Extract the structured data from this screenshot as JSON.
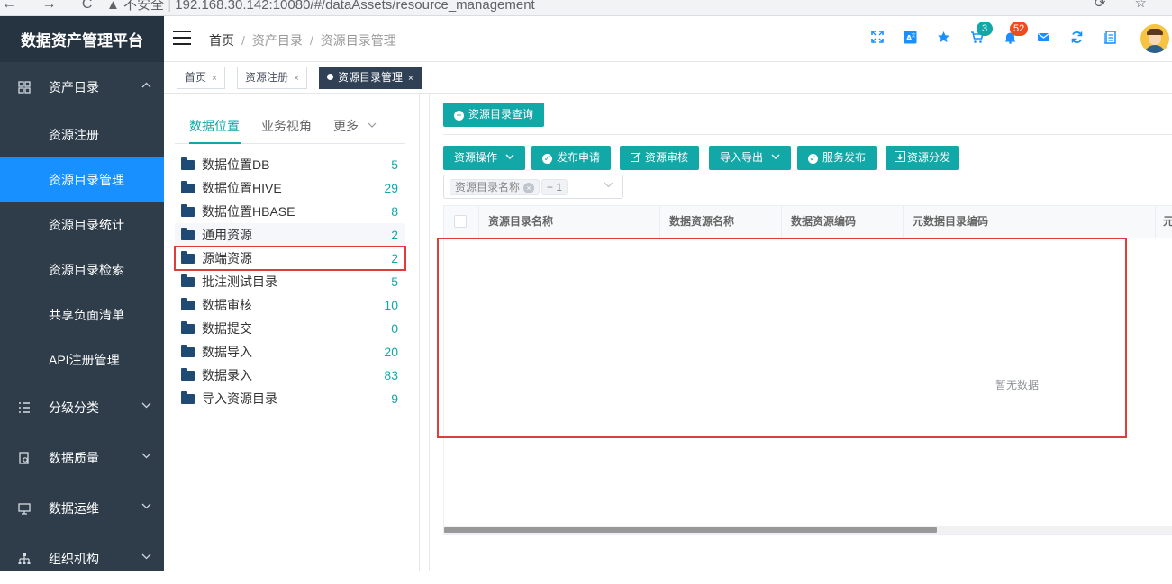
{
  "browser": {
    "nav_glyphs": "← → C",
    "security": "▲ 不安全",
    "url": "192.168.30.142:10080/#/dataAssets/resource_management",
    "right_glyphs": "⟳ ☆"
  },
  "sidebar": {
    "title": "数据资产管理平台",
    "group_assets": {
      "label": "资产目录",
      "icon": "grid-icon",
      "arrow": "^"
    },
    "sub_items": [
      {
        "label": "资源注册",
        "active": false
      },
      {
        "label": "资源目录管理",
        "active": true
      },
      {
        "label": "资源目录统计",
        "active": false
      },
      {
        "label": "资源目录检索",
        "active": false
      },
      {
        "label": "共享负面清单",
        "active": false
      },
      {
        "label": "API注册管理",
        "active": false
      }
    ],
    "groups": [
      {
        "label": "分级分类",
        "icon": "list-icon",
        "arrow": "⌄"
      },
      {
        "label": "数据质量",
        "icon": "doc-search-icon",
        "arrow": "⌄"
      },
      {
        "label": "数据运维",
        "icon": "monitor-icon",
        "arrow": "⌄"
      },
      {
        "label": "组织机构",
        "icon": "org-icon",
        "arrow": "⌄"
      }
    ]
  },
  "header": {
    "breadcrumb": [
      "首页",
      "资产目录",
      "资源目录管理"
    ],
    "cart_badge": "3",
    "bell_badge": "52"
  },
  "tags": [
    {
      "label": "首页"
    },
    {
      "label": "资源注册"
    },
    {
      "label": "资源目录管理"
    }
  ],
  "tree": {
    "tabs": [
      "数据位置",
      "业务视角",
      "更多"
    ],
    "items": [
      {
        "label": "数据位置DB",
        "count": "5"
      },
      {
        "label": "数据位置HIVE",
        "count": "29"
      },
      {
        "label": "数据位置HBASE",
        "count": "8"
      },
      {
        "label": "通用资源",
        "count": "2"
      },
      {
        "label": "源端资源",
        "count": "2"
      },
      {
        "label": "批注测试目录",
        "count": "5"
      },
      {
        "label": "数据审核",
        "count": "10"
      },
      {
        "label": "数据提交",
        "count": "0"
      },
      {
        "label": "数据导入",
        "count": "20"
      },
      {
        "label": "数据录入",
        "count": "83"
      },
      {
        "label": "导入资源目录",
        "count": "9"
      }
    ]
  },
  "main": {
    "query_button": "资源目录查询",
    "toolbar": {
      "resource_ops": "资源操作",
      "publish_apply": "发布申请",
      "resource_audit": "资源审核",
      "import_export": "导入导出",
      "service_publish": "服务发布",
      "resource_dispatch": "资源分发"
    },
    "filter": {
      "chip": "资源目录名称",
      "more": "+ 1"
    },
    "columns": [
      "资源目录名称",
      "数据资源名称",
      "数据资源编码",
      "元数据目录编码",
      "元"
    ],
    "empty_text": "暂无数据"
  }
}
